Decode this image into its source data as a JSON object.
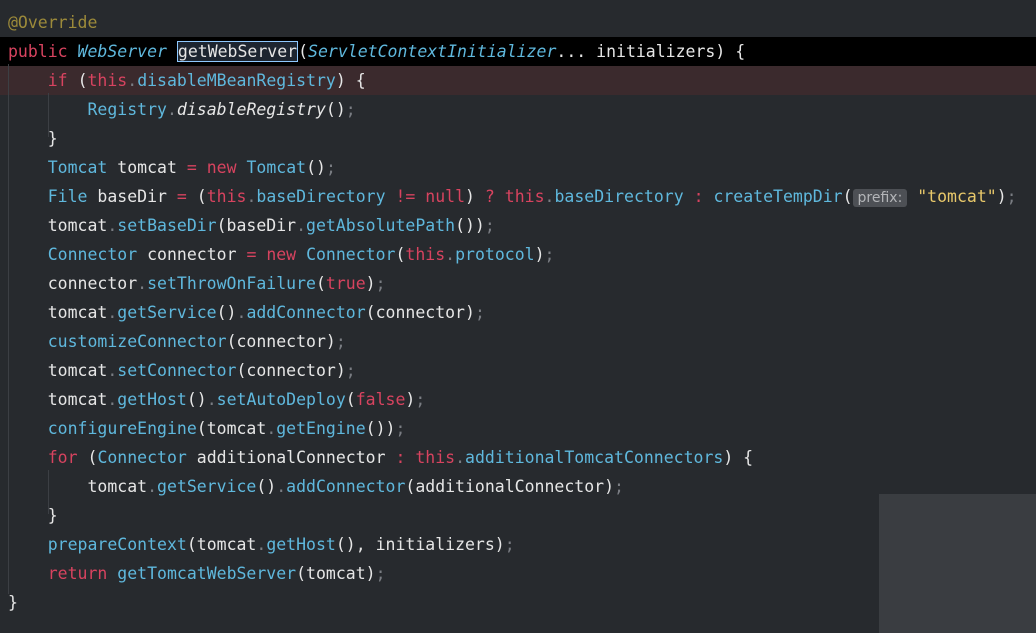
{
  "code": {
    "lines": [
      {
        "class": "",
        "tokens": [
          [
            "tok-ann",
            "@Override"
          ]
        ]
      },
      {
        "class": "current",
        "tokens": [
          [
            "tok-kw",
            "public "
          ],
          [
            "tok-type-i",
            "WebServer "
          ],
          [
            "tok-sel",
            "getWebServer"
          ],
          [
            "tok-punc",
            "("
          ],
          [
            "tok-param-i",
            "ServletContextInitializer"
          ],
          [
            "tok-punc",
            "... initializers) {"
          ]
        ]
      },
      {
        "class": "breakpoint",
        "tokens": [
          [
            "tok-id",
            "    "
          ],
          [
            "tok-kw",
            "if "
          ],
          [
            "tok-punc",
            "("
          ],
          [
            "tok-this",
            "this"
          ],
          [
            "tok-dot",
            "."
          ],
          [
            "tok-field",
            "disableMBeanRegistry"
          ],
          [
            "tok-punc",
            ") {"
          ]
        ]
      },
      {
        "class": "",
        "tokens": [
          [
            "tok-id",
            "        "
          ],
          [
            "tok-type",
            "Registry"
          ],
          [
            "tok-dot",
            "."
          ],
          [
            "tok-italic",
            "disableRegistry"
          ],
          [
            "tok-punc",
            "()"
          ],
          [
            "tok-semi",
            ";"
          ]
        ]
      },
      {
        "class": "",
        "tokens": [
          [
            "tok-punc",
            "    }"
          ]
        ]
      },
      {
        "class": "",
        "tokens": [
          [
            "tok-id",
            "    "
          ],
          [
            "tok-type",
            "Tomcat "
          ],
          [
            "tok-id",
            "tomcat "
          ],
          [
            "tok-op",
            "= "
          ],
          [
            "tok-kw",
            "new "
          ],
          [
            "tok-type",
            "Tomcat"
          ],
          [
            "tok-punc",
            "()"
          ],
          [
            "tok-semi",
            ";"
          ]
        ]
      },
      {
        "class": "",
        "tokens": [
          [
            "tok-id",
            "    "
          ],
          [
            "tok-type",
            "File "
          ],
          [
            "tok-id",
            "baseDir "
          ],
          [
            "tok-op",
            "= "
          ],
          [
            "tok-punc",
            "("
          ],
          [
            "tok-this",
            "this"
          ],
          [
            "tok-dot",
            "."
          ],
          [
            "tok-field",
            "baseDirectory "
          ],
          [
            "tok-op",
            "!= "
          ],
          [
            "tok-lit",
            "null"
          ],
          [
            "tok-punc",
            ") "
          ],
          [
            "tok-op",
            "? "
          ],
          [
            "tok-this",
            "this"
          ],
          [
            "tok-dot",
            "."
          ],
          [
            "tok-field",
            "baseDirectory "
          ],
          [
            "tok-op",
            ": "
          ],
          [
            "tok-method",
            "createTempDir"
          ],
          [
            "tok-punc",
            "("
          ],
          [
            "tok-hint",
            "prefix:"
          ],
          [
            "tok-str",
            " \"tomcat\""
          ],
          [
            "tok-punc",
            ")"
          ],
          [
            "tok-semi",
            ";"
          ]
        ]
      },
      {
        "class": "",
        "tokens": [
          [
            "tok-id",
            "    tomcat"
          ],
          [
            "tok-dot",
            "."
          ],
          [
            "tok-method",
            "setBaseDir"
          ],
          [
            "tok-punc",
            "(baseDir"
          ],
          [
            "tok-dot",
            "."
          ],
          [
            "tok-method",
            "getAbsolutePath"
          ],
          [
            "tok-punc",
            "())"
          ],
          [
            "tok-semi",
            ";"
          ]
        ]
      },
      {
        "class": "",
        "tokens": [
          [
            "tok-id",
            "    "
          ],
          [
            "tok-type",
            "Connector "
          ],
          [
            "tok-id",
            "connector "
          ],
          [
            "tok-op",
            "= "
          ],
          [
            "tok-kw",
            "new "
          ],
          [
            "tok-type",
            "Connector"
          ],
          [
            "tok-punc",
            "("
          ],
          [
            "tok-this",
            "this"
          ],
          [
            "tok-dot",
            "."
          ],
          [
            "tok-field",
            "protocol"
          ],
          [
            "tok-punc",
            ")"
          ],
          [
            "tok-semi",
            ";"
          ]
        ]
      },
      {
        "class": "",
        "tokens": [
          [
            "tok-id",
            "    connector"
          ],
          [
            "tok-dot",
            "."
          ],
          [
            "tok-method",
            "setThrowOnFailure"
          ],
          [
            "tok-punc",
            "("
          ],
          [
            "tok-lit",
            "true"
          ],
          [
            "tok-punc",
            ")"
          ],
          [
            "tok-semi",
            ";"
          ]
        ]
      },
      {
        "class": "",
        "tokens": [
          [
            "tok-id",
            "    tomcat"
          ],
          [
            "tok-dot",
            "."
          ],
          [
            "tok-method",
            "getService"
          ],
          [
            "tok-punc",
            "()"
          ],
          [
            "tok-dot",
            "."
          ],
          [
            "tok-method",
            "addConnector"
          ],
          [
            "tok-punc",
            "(connector)"
          ],
          [
            "tok-semi",
            ";"
          ]
        ]
      },
      {
        "class": "",
        "tokens": [
          [
            "tok-id",
            "    "
          ],
          [
            "tok-method",
            "customizeConnector"
          ],
          [
            "tok-punc",
            "(connector)"
          ],
          [
            "tok-semi",
            ";"
          ]
        ]
      },
      {
        "class": "",
        "tokens": [
          [
            "tok-id",
            "    tomcat"
          ],
          [
            "tok-dot",
            "."
          ],
          [
            "tok-method",
            "setConnector"
          ],
          [
            "tok-punc",
            "(connector)"
          ],
          [
            "tok-semi",
            ";"
          ]
        ]
      },
      {
        "class": "",
        "tokens": [
          [
            "tok-id",
            "    tomcat"
          ],
          [
            "tok-dot",
            "."
          ],
          [
            "tok-method",
            "getHost"
          ],
          [
            "tok-punc",
            "()"
          ],
          [
            "tok-dot",
            "."
          ],
          [
            "tok-method",
            "setAutoDeploy"
          ],
          [
            "tok-punc",
            "("
          ],
          [
            "tok-lit",
            "false"
          ],
          [
            "tok-punc",
            ")"
          ],
          [
            "tok-semi",
            ";"
          ]
        ]
      },
      {
        "class": "",
        "tokens": [
          [
            "tok-id",
            "    "
          ],
          [
            "tok-method",
            "configureEngine"
          ],
          [
            "tok-punc",
            "(tomcat"
          ],
          [
            "tok-dot",
            "."
          ],
          [
            "tok-method",
            "getEngine"
          ],
          [
            "tok-punc",
            "())"
          ],
          [
            "tok-semi",
            ";"
          ]
        ]
      },
      {
        "class": "",
        "tokens": [
          [
            "tok-id",
            "    "
          ],
          [
            "tok-kw",
            "for "
          ],
          [
            "tok-punc",
            "("
          ],
          [
            "tok-type",
            "Connector "
          ],
          [
            "tok-id",
            "additionalConnector "
          ],
          [
            "tok-op",
            ": "
          ],
          [
            "tok-this",
            "this"
          ],
          [
            "tok-dot",
            "."
          ],
          [
            "tok-field",
            "additionalTomcatConnectors"
          ],
          [
            "tok-punc",
            ") {"
          ]
        ]
      },
      {
        "class": "",
        "tokens": [
          [
            "tok-id",
            "        tomcat"
          ],
          [
            "tok-dot",
            "."
          ],
          [
            "tok-method",
            "getService"
          ],
          [
            "tok-punc",
            "()"
          ],
          [
            "tok-dot",
            "."
          ],
          [
            "tok-method",
            "addConnector"
          ],
          [
            "tok-punc",
            "(additionalConnector)"
          ],
          [
            "tok-semi",
            ";"
          ]
        ]
      },
      {
        "class": "",
        "tokens": [
          [
            "tok-punc",
            "    }"
          ]
        ]
      },
      {
        "class": "",
        "tokens": [
          [
            "tok-id",
            "    "
          ],
          [
            "tok-method",
            "prepareContext"
          ],
          [
            "tok-punc",
            "(tomcat"
          ],
          [
            "tok-dot",
            "."
          ],
          [
            "tok-method",
            "getHost"
          ],
          [
            "tok-punc",
            "(), initializers)"
          ],
          [
            "tok-semi",
            ";"
          ]
        ]
      },
      {
        "class": "",
        "tokens": [
          [
            "tok-id",
            "    "
          ],
          [
            "tok-kw",
            "return "
          ],
          [
            "tok-method",
            "getTomcatWebServer"
          ],
          [
            "tok-punc",
            "(tomcat)"
          ],
          [
            "tok-semi",
            ";"
          ]
        ]
      },
      {
        "class": "",
        "tokens": [
          [
            "tok-punc",
            "}"
          ]
        ]
      }
    ]
  }
}
